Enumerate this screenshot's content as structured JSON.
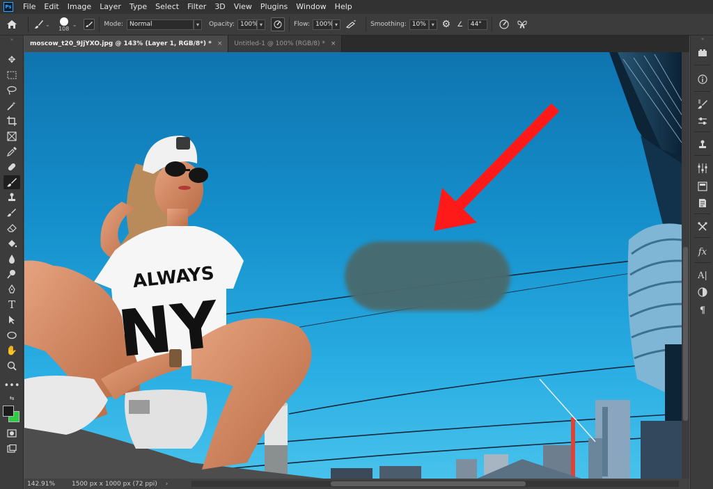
{
  "app": {
    "logo": "Ps"
  },
  "menu": [
    "File",
    "Edit",
    "Image",
    "Layer",
    "Type",
    "Select",
    "Filter",
    "3D",
    "View",
    "Plugins",
    "Window",
    "Help"
  ],
  "options": {
    "brush_size": "108",
    "mode_label": "Mode:",
    "mode_value": "Normal",
    "opacity_label": "Opacity:",
    "opacity_value": "100%",
    "flow_label": "Flow:",
    "flow_value": "100%",
    "smoothing_label": "Smoothing:",
    "smoothing_value": "10%",
    "angle_value": "44°"
  },
  "tabs": [
    {
      "label": "moscow_t20_9JjYXO.jpg @ 143% (Layer 1, RGB/8*) *",
      "close": "×"
    },
    {
      "label": "Untitled-1 @ 100% (RGB/8) *",
      "close": "×"
    }
  ],
  "canvas": {
    "shirt_line1": "ALWAYS",
    "shirt_line2": "NY",
    "arrow_color": "#ff1a1a",
    "blob_color": "#4a6a6d",
    "sky_color": "#1590cc"
  },
  "status": {
    "zoom": "142.91%",
    "doc_size": "1500 px x 1000 px (72 ppi)"
  },
  "colors": {
    "foreground": "#1b1b1b",
    "background": "#2ecc40"
  }
}
